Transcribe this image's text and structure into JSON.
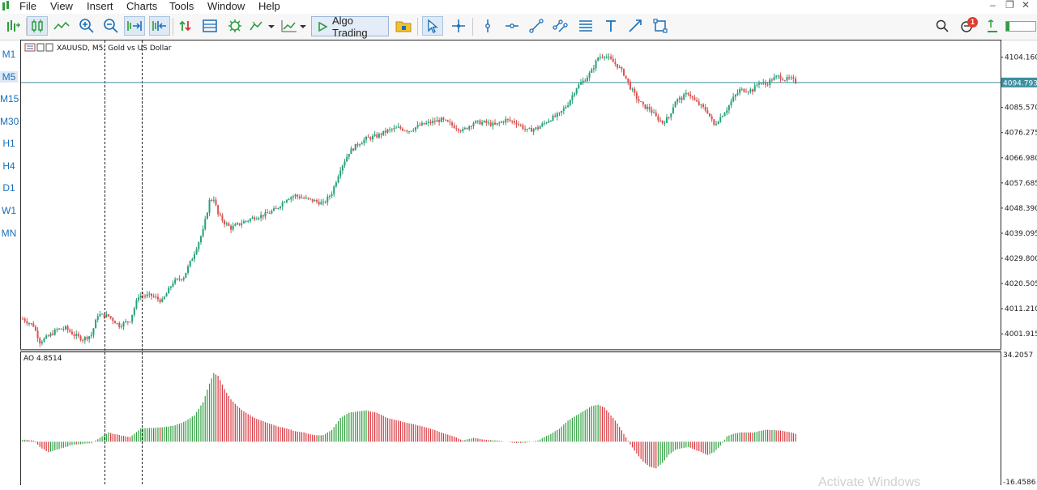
{
  "menu": [
    "File",
    "View",
    "Insert",
    "Charts",
    "Tools",
    "Window",
    "Help"
  ],
  "window_controls": [
    "–",
    "❐",
    "✕"
  ],
  "toolbar": {
    "algo_trading_label": "Algo Trading",
    "notification_count": "1",
    "icons": [
      "new-order-icon",
      "candles-icon",
      "line-chart-icon",
      "zoom-in-icon",
      "zoom-out-icon",
      "autoscroll-icon",
      "chart-shift-icon",
      "buy-sell-icon",
      "templates-icon",
      "indicators-icon",
      "chart-type-icon",
      "timeframe-icon",
      "algo-trading-icon",
      "folder-icon",
      "cursor-icon",
      "crosshair-icon",
      "vertical-line-icon",
      "horizontal-line-icon",
      "trendline-icon",
      "channel-icon",
      "fibo-icon",
      "text-icon",
      "arrow-icon",
      "shapes-icon",
      "search-icon",
      "notifications-icon",
      "signal-level-icon"
    ]
  },
  "timeframes": [
    "M1",
    "M5",
    "M15",
    "M30",
    "H1",
    "H4",
    "D1",
    "W1",
    "MN"
  ],
  "active_timeframe": "M5",
  "watermark": "Activate Windows",
  "chart_data": [
    {
      "type": "candlestick",
      "header": "XAUUSD, M5:  Gold vs US Dollar",
      "y_ticks": [
        "4104.160",
        "4094.793",
        "4085.570",
        "4076.275",
        "4066.980",
        "4057.685",
        "4048.390",
        "4039.095",
        "4029.800",
        "4020.505",
        "4011.210",
        "4001.915"
      ],
      "current_price": "4094.793",
      "ylim": [
        3996.3,
        4110.6
      ],
      "grid": false,
      "up_color": "#26a07a",
      "down_color": "#d9534f",
      "anchors": [
        [
          0,
          4007.5
        ],
        [
          5,
          4005
        ],
        [
          8,
          3999
        ],
        [
          12,
          4001
        ],
        [
          16,
          4003.5
        ],
        [
          20,
          4004
        ],
        [
          24,
          4001.5
        ],
        [
          28,
          4000
        ],
        [
          32,
          4001.5
        ],
        [
          35,
          4009
        ],
        [
          40,
          4008.5
        ],
        [
          45,
          4005
        ],
        [
          50,
          4007
        ],
        [
          54,
          4016
        ],
        [
          60,
          4016
        ],
        [
          65,
          4014
        ],
        [
          70,
          4021
        ],
        [
          75,
          4023
        ],
        [
          79,
          4030
        ],
        [
          84,
          4040
        ],
        [
          87,
          4051
        ],
        [
          89,
          4052
        ],
        [
          91,
          4046
        ],
        [
          94,
          4043
        ],
        [
          97,
          4041
        ],
        [
          102,
          4043
        ],
        [
          108,
          4045
        ],
        [
          113,
          4046
        ],
        [
          118,
          4048
        ],
        [
          123,
          4052
        ],
        [
          127,
          4053
        ],
        [
          131,
          4052
        ],
        [
          136,
          4051
        ],
        [
          140,
          4050
        ],
        [
          144,
          4054
        ],
        [
          148,
          4063
        ],
        [
          152,
          4069
        ],
        [
          156,
          4072
        ],
        [
          160,
          4074
        ],
        [
          165,
          4075
        ],
        [
          170,
          4077
        ],
        [
          175,
          4078
        ],
        [
          180,
          4077
        ],
        [
          185,
          4079
        ],
        [
          190,
          4080
        ],
        [
          195,
          4081
        ],
        [
          200,
          4079
        ],
        [
          205,
          4077
        ],
        [
          210,
          4080
        ],
        [
          215,
          4080
        ],
        [
          220,
          4079
        ],
        [
          225,
          4081
        ],
        [
          230,
          4080
        ],
        [
          235,
          4077
        ],
        [
          240,
          4078
        ],
        [
          245,
          4081
        ],
        [
          250,
          4083
        ],
        [
          254,
          4087
        ],
        [
          258,
          4093
        ],
        [
          262,
          4096
        ],
        [
          265,
          4099
        ],
        [
          268,
          4104
        ],
        [
          271,
          4105
        ],
        [
          274,
          4103
        ],
        [
          277,
          4101
        ],
        [
          280,
          4098
        ],
        [
          283,
          4093
        ],
        [
          286,
          4089
        ],
        [
          289,
          4086
        ],
        [
          292,
          4085
        ],
        [
          295,
          4082
        ],
        [
          298,
          4080
        ],
        [
          301,
          4082
        ],
        [
          304,
          4088
        ],
        [
          307,
          4089
        ],
        [
          310,
          4091
        ],
        [
          313,
          4088
        ],
        [
          316,
          4086
        ],
        [
          319,
          4084
        ],
        [
          322,
          4079
        ],
        [
          325,
          4082
        ],
        [
          328,
          4085
        ],
        [
          331,
          4089
        ],
        [
          334,
          4092
        ],
        [
          337,
          4092
        ],
        [
          340,
          4092
        ],
        [
          343,
          4095
        ],
        [
          346,
          4094
        ],
        [
          349,
          4096
        ],
        [
          352,
          4097
        ],
        [
          355,
          4096
        ],
        [
          358,
          4096
        ],
        [
          360,
          4095
        ]
      ]
    },
    {
      "type": "bar",
      "header": "AO 4.8514",
      "y_ticks": [
        "34.2057",
        "-16.4586"
      ],
      "ylim": [
        -16.4586,
        34.2057
      ],
      "up_color": "#2e9e3e",
      "down_color": "#d8343c",
      "anchors": [
        [
          0,
          0.8
        ],
        [
          5,
          0.5
        ],
        [
          8,
          -2
        ],
        [
          12,
          -4
        ],
        [
          16,
          -3
        ],
        [
          20,
          -2
        ],
        [
          24,
          -1
        ],
        [
          28,
          -0.8
        ],
        [
          32,
          -0.5
        ],
        [
          35,
          1
        ],
        [
          40,
          3.5
        ],
        [
          45,
          2.5
        ],
        [
          50,
          1.8
        ],
        [
          55,
          5
        ],
        [
          60,
          5.2
        ],
        [
          65,
          5.5
        ],
        [
          70,
          6
        ],
        [
          75,
          7.5
        ],
        [
          80,
          10
        ],
        [
          84,
          15
        ],
        [
          87,
          22
        ],
        [
          89,
          26
        ],
        [
          91,
          25
        ],
        [
          94,
          20
        ],
        [
          97,
          16
        ],
        [
          102,
          12
        ],
        [
          108,
          9
        ],
        [
          113,
          7.5
        ],
        [
          118,
          6
        ],
        [
          123,
          5
        ],
        [
          127,
          4
        ],
        [
          131,
          3.5
        ],
        [
          136,
          2.5
        ],
        [
          140,
          2.5
        ],
        [
          144,
          4.5
        ],
        [
          148,
          9
        ],
        [
          152,
          11
        ],
        [
          156,
          11.5
        ],
        [
          160,
          11.8
        ],
        [
          165,
          11
        ],
        [
          170,
          9
        ],
        [
          175,
          8
        ],
        [
          180,
          7
        ],
        [
          185,
          6
        ],
        [
          190,
          5
        ],
        [
          195,
          3.5
        ],
        [
          200,
          2.2
        ],
        [
          205,
          0.5
        ],
        [
          210,
          1.5
        ],
        [
          215,
          0.8
        ],
        [
          220,
          0.5
        ],
        [
          225,
          0
        ],
        [
          230,
          -0.5
        ],
        [
          235,
          -0.3
        ],
        [
          240,
          0.5
        ],
        [
          245,
          2.5
        ],
        [
          250,
          5
        ],
        [
          254,
          8
        ],
        [
          258,
          10
        ],
        [
          262,
          12
        ],
        [
          265,
          13.5
        ],
        [
          268,
          14
        ],
        [
          271,
          13
        ],
        [
          274,
          10
        ],
        [
          277,
          7
        ],
        [
          280,
          3
        ],
        [
          283,
          -1
        ],
        [
          286,
          -4.5
        ],
        [
          289,
          -7.5
        ],
        [
          292,
          -9.5
        ],
        [
          295,
          -10
        ],
        [
          298,
          -8
        ],
        [
          301,
          -5
        ],
        [
          304,
          -3
        ],
        [
          307,
          -2.5
        ],
        [
          310,
          -2
        ],
        [
          313,
          -3
        ],
        [
          316,
          -4
        ],
        [
          319,
          -5
        ],
        [
          322,
          -4
        ],
        [
          325,
          -1.5
        ],
        [
          328,
          2
        ],
        [
          331,
          3
        ],
        [
          334,
          3.5
        ],
        [
          337,
          3.5
        ],
        [
          340,
          3.5
        ],
        [
          343,
          4
        ],
        [
          346,
          4.5
        ],
        [
          349,
          4.5
        ],
        [
          352,
          4.3
        ],
        [
          355,
          4
        ],
        [
          358,
          3.5
        ],
        [
          360,
          3
        ]
      ]
    }
  ]
}
